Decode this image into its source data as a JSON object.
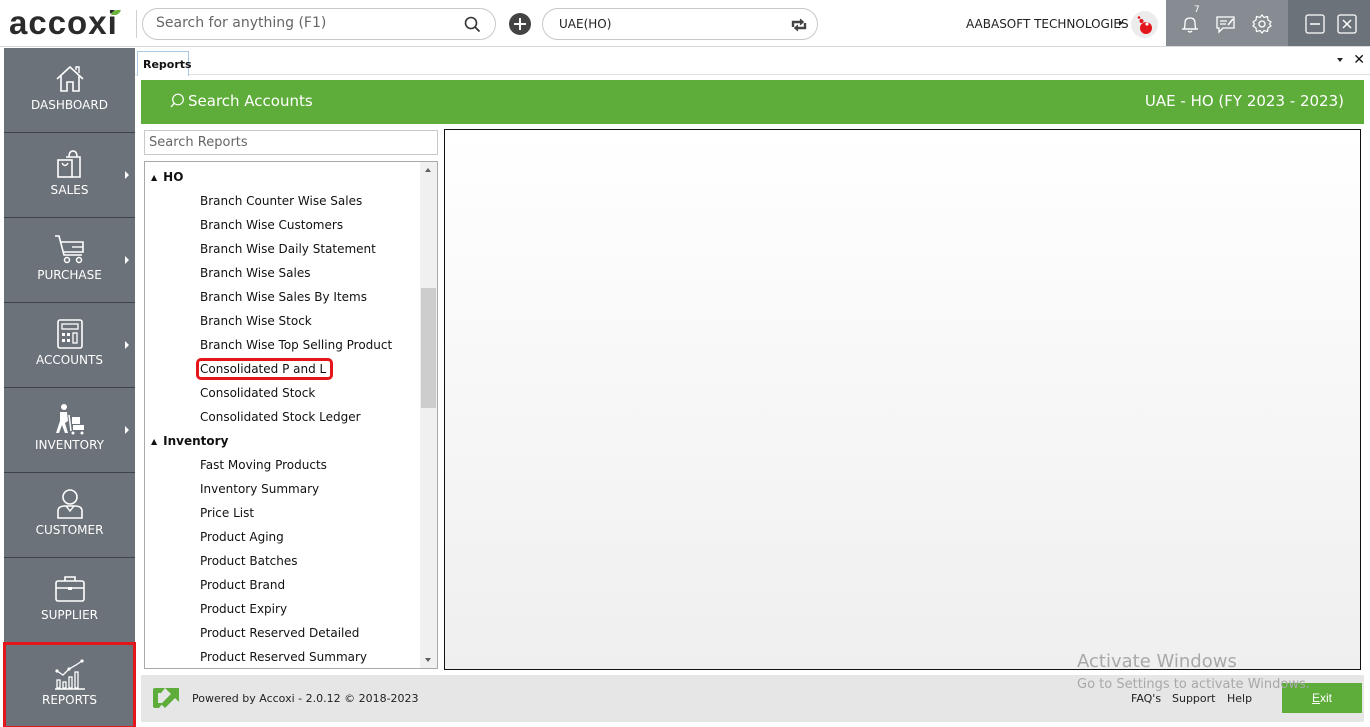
{
  "app": {
    "logo_text": "accoxi",
    "global_search_placeholder": "Search for anything (F1)",
    "branch": "UAE(HO)",
    "company_name": "AABASOFT TECHNOLOGIES",
    "notification_count": "7"
  },
  "sidebar": {
    "items": [
      {
        "label": "DASHBOARD",
        "icon": "home-icon",
        "has_submenu": false
      },
      {
        "label": "SALES",
        "icon": "shopping-bag-icon",
        "has_submenu": true
      },
      {
        "label": "PURCHASE",
        "icon": "cart-icon",
        "has_submenu": true
      },
      {
        "label": "ACCOUNTS",
        "icon": "calculator-icon",
        "has_submenu": true
      },
      {
        "label": "INVENTORY",
        "icon": "inventory-worker-icon",
        "has_submenu": true
      },
      {
        "label": "CUSTOMER",
        "icon": "user-icon",
        "has_submenu": false
      },
      {
        "label": "SUPPLIER",
        "icon": "briefcase-icon",
        "has_submenu": false
      },
      {
        "label": "REPORTS",
        "icon": "chart-icon",
        "has_submenu": false,
        "active": true
      }
    ]
  },
  "tabs": [
    {
      "label": "Reports",
      "active": true
    }
  ],
  "header": {
    "search_label": "Search Accounts",
    "fy_label": "UAE - HO (FY 2023 - 2023)"
  },
  "reports": {
    "search_placeholder": "Search Reports",
    "groups": [
      {
        "name": "HO",
        "expanded": true,
        "items": [
          "Branch Counter Wise Sales",
          "Branch Wise Customers",
          "Branch Wise Daily Statement",
          "Branch Wise Sales",
          "Branch Wise Sales By Items",
          "Branch Wise Stock",
          "Branch Wise Top Selling Product",
          "Consolidated P and L",
          "Consolidated Stock",
          "Consolidated Stock Ledger"
        ]
      },
      {
        "name": "Inventory",
        "expanded": true,
        "items": [
          "Fast Moving Products",
          "Inventory Summary",
          "Price List",
          "Product Aging",
          "Product Batches",
          "Product Brand",
          "Product Expiry",
          "Product Reserved Detailed",
          "Product Reserved Summary"
        ]
      }
    ],
    "highlighted_item": "Consolidated P and L"
  },
  "footer": {
    "powered_by": "Powered by Accoxi - 2.0.12 © 2018-2023",
    "links": [
      "FAQ's",
      "Support",
      "Help"
    ],
    "exit_label_underlined": "E",
    "exit_label_rest": "xit"
  },
  "watermark": {
    "line1": "Activate Windows",
    "line2": "Go to Settings to activate Windows."
  },
  "colors": {
    "accent_green": "#5ead3a",
    "sidebar_bg": "#6c7279",
    "highlight_red": "#e3161b"
  }
}
